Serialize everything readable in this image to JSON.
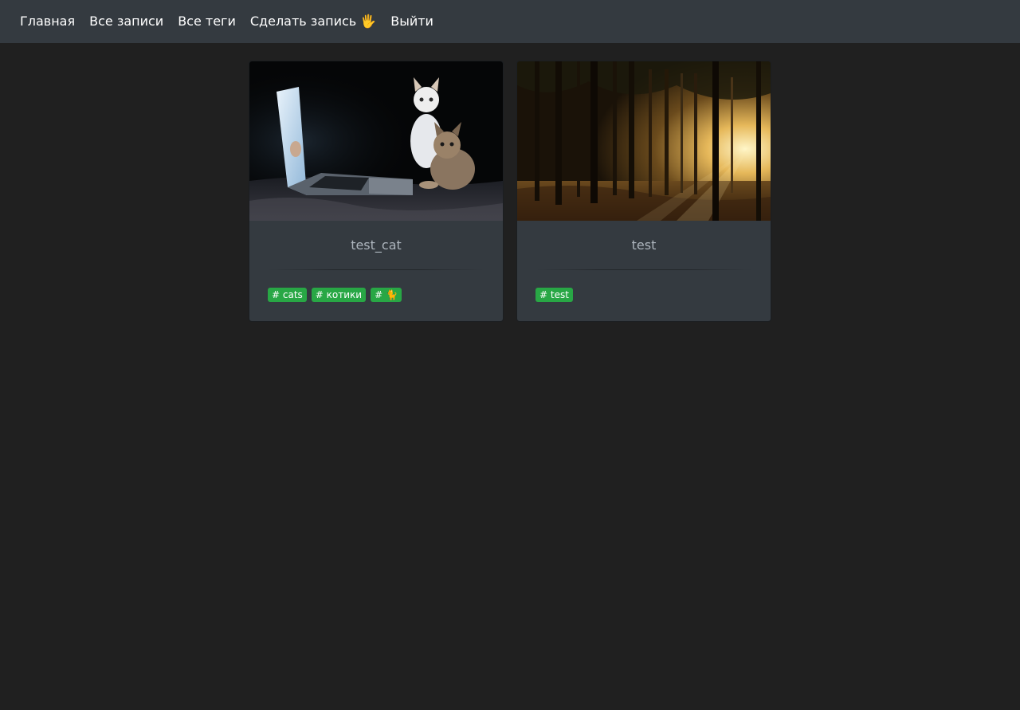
{
  "navbar": {
    "items": [
      {
        "label": "Главная"
      },
      {
        "label": "Все записи"
      },
      {
        "label": "Все теги"
      },
      {
        "label": "Сделать запись 🖐"
      },
      {
        "label": "Выйти"
      }
    ]
  },
  "posts": [
    {
      "title": "test_cat",
      "tags": [
        "# cats",
        "# котики",
        "# 🐈"
      ]
    },
    {
      "title": "test",
      "tags": [
        "# test"
      ]
    }
  ]
}
